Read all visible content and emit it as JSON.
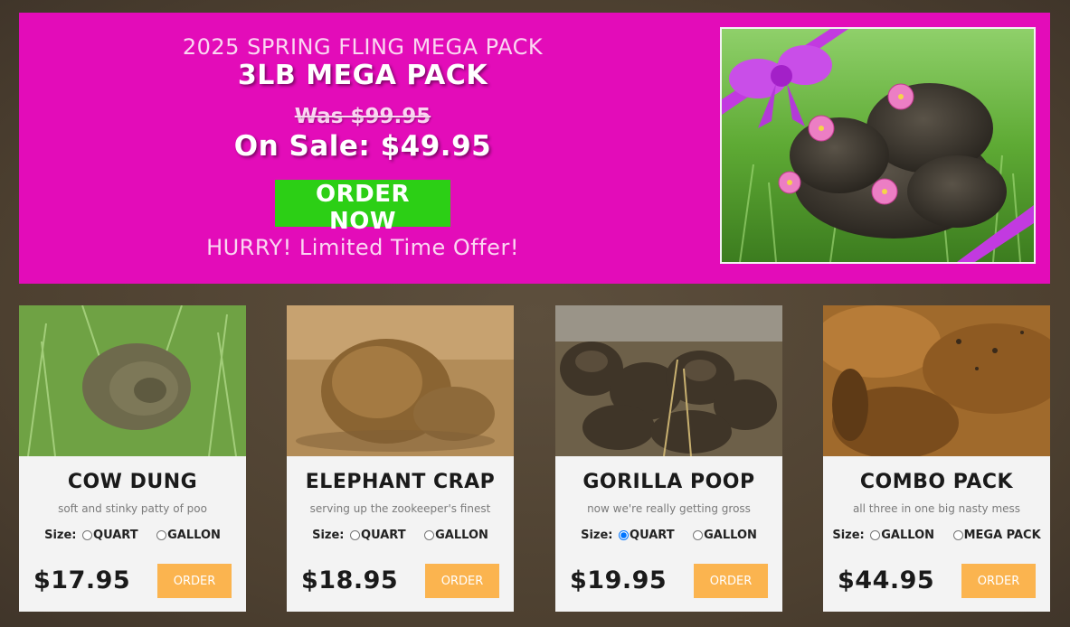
{
  "hero": {
    "subtitle": "2025 SPRING FLING MEGA PACK",
    "title": "3LB MEGA PACK",
    "was_price": "Was $99.95",
    "sale_price": "On Sale: $49.95",
    "order_label": "ORDER NOW",
    "hurry": "HURRY! Limited Time Offer!"
  },
  "size_label": "Size:",
  "order_label": "ORDER",
  "products": [
    {
      "name": "COW DUNG",
      "desc": "soft and stinky patty of poo",
      "options": [
        "QUART",
        "GALLON"
      ],
      "selected": -1,
      "price": "$17.95"
    },
    {
      "name": "ELEPHANT CRAP",
      "desc": "serving up the zookeeper's finest",
      "options": [
        "QUART",
        "GALLON"
      ],
      "selected": -1,
      "price": "$18.95"
    },
    {
      "name": "GORILLA POOP",
      "desc": "now we're really getting gross",
      "options": [
        "QUART",
        "GALLON"
      ],
      "selected": 0,
      "price": "$19.95"
    },
    {
      "name": "COMBO PACK",
      "desc": "all three in one big nasty mess",
      "options": [
        "GALLON",
        "MEGA PACK"
      ],
      "selected": -1,
      "price": "$44.95"
    }
  ],
  "colors": {
    "hero_bg": "#e30cb9",
    "order_now_bg": "#2ccf15",
    "order_bg": "#fbb44f",
    "page_bg": "#4d4030"
  }
}
